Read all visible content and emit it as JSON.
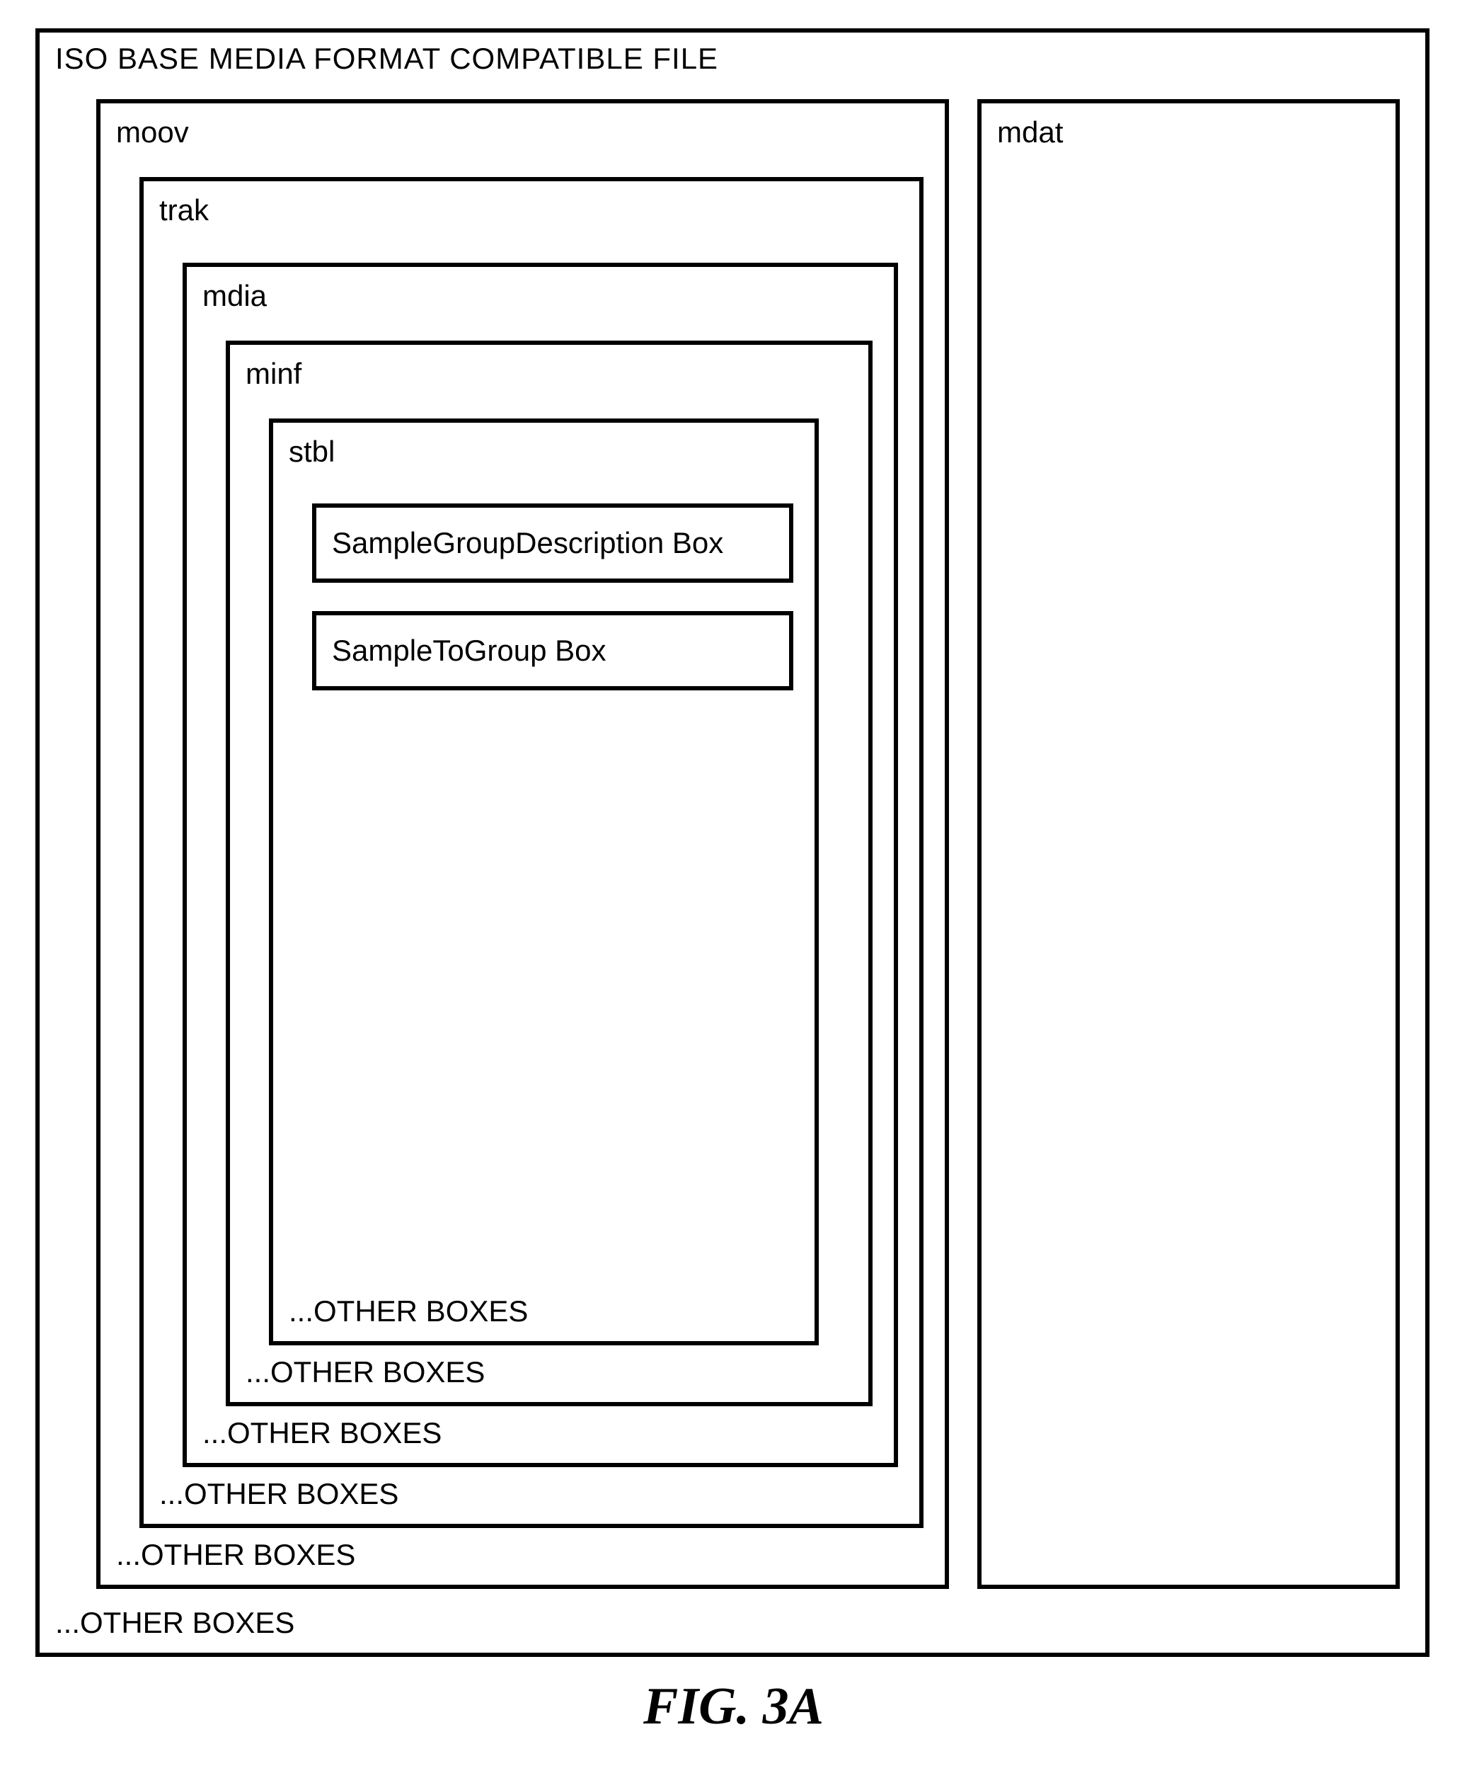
{
  "figure_caption": "FIG. 3A",
  "file": {
    "title": "ISO BASE MEDIA FORMAT COMPATIBLE FILE",
    "other": "...OTHER BOXES",
    "moov": {
      "label": "moov",
      "other": "...OTHER BOXES",
      "trak": {
        "label": "trak",
        "other": "...OTHER BOXES",
        "mdia": {
          "label": "mdia",
          "other": "...OTHER BOXES",
          "minf": {
            "label": "minf",
            "other": "...OTHER BOXES",
            "stbl": {
              "label": "stbl",
              "other": "...OTHER BOXES",
              "sgpd": "SampleGroupDescription Box",
              "sbgp": "SampleToGroup Box"
            }
          }
        }
      }
    },
    "mdat": {
      "label": "mdat"
    }
  }
}
